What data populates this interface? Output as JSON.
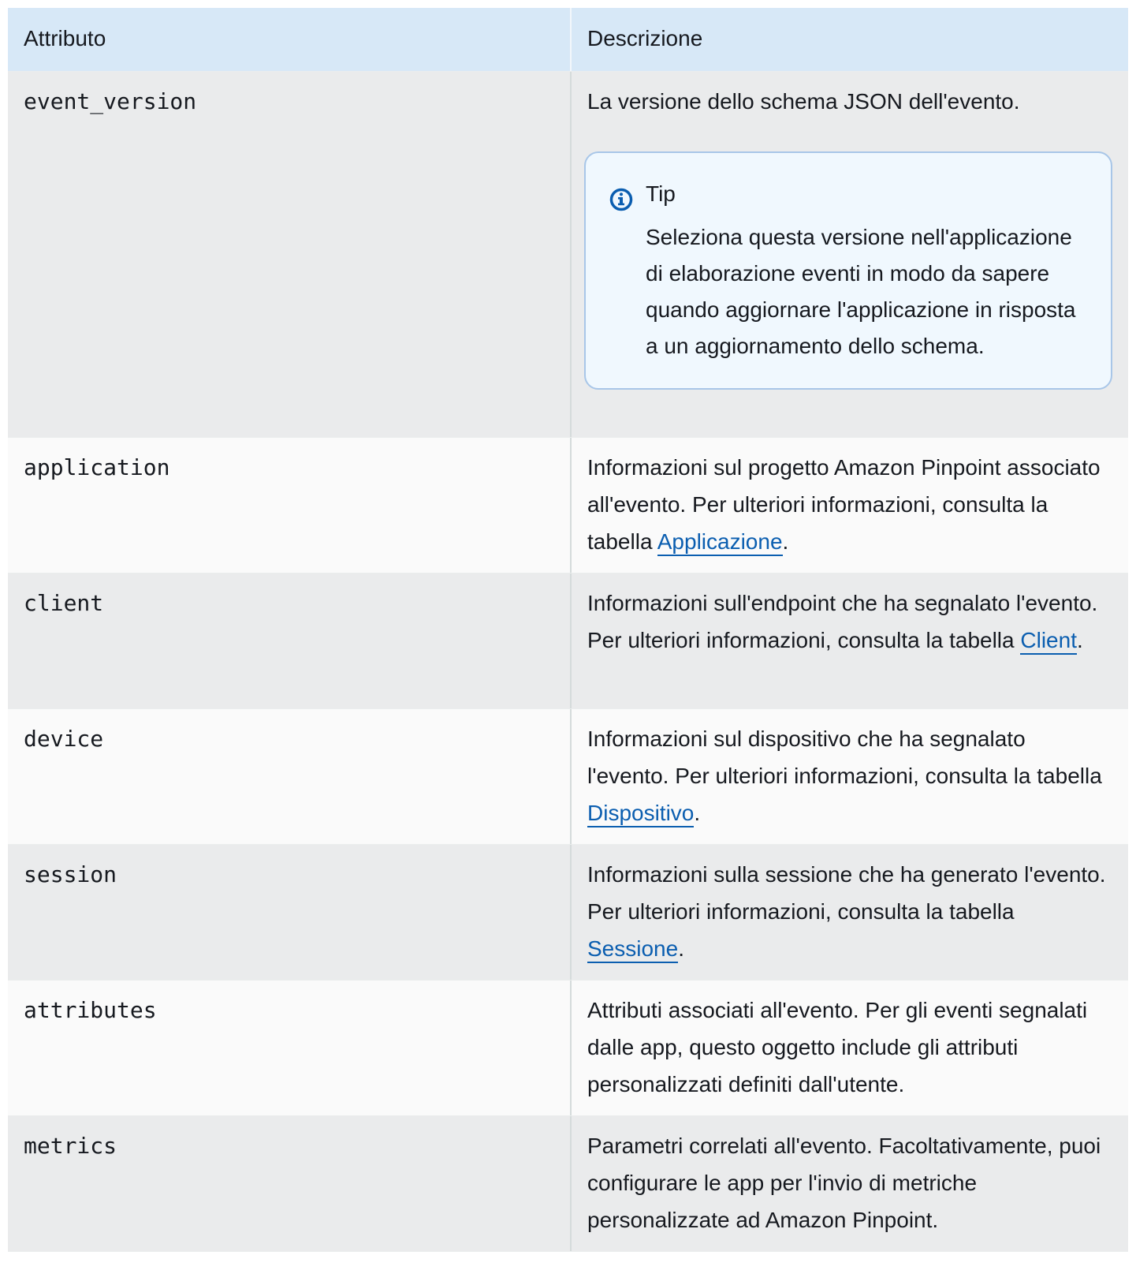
{
  "table": {
    "headers": {
      "attribute": "Attributo",
      "description": "Descrizione"
    },
    "rows": [
      {
        "attribute": "event_version",
        "description": "La versione dello schema JSON dell'evento.",
        "tip": {
          "title": "Tip",
          "icon": "info-icon",
          "text": "Seleziona questa versione nell'applicazione di elaborazione eventi in modo da sapere quando aggiornare l'applicazione in risposta a un aggiornamento dello schema."
        }
      },
      {
        "attribute": "application",
        "description_before": "Informazioni sul progetto Amazon Pinpoint associato all'evento. Per ulteriori informazioni, consulta la tabella ",
        "link": "Applicazione",
        "description_after": "."
      },
      {
        "attribute": "client",
        "description_before": "Informazioni sull'endpoint che ha segnalato l'evento. Per ulteriori informazioni, consulta la tabella ",
        "link": "Client",
        "description_after": "."
      },
      {
        "attribute": "device",
        "description_before": "Informazioni sul dispositivo che ha segnalato l'evento. Per ulteriori informazioni, consulta la tabella ",
        "link": "Dispositivo",
        "description_after": "."
      },
      {
        "attribute": "session",
        "description_before": "Informazioni sulla sessione che ha generato l'evento. Per ulteriori informazioni, consulta la tabella ",
        "link": "Sessione",
        "description_after": "."
      },
      {
        "attribute": "attributes",
        "description": "Attributi associati all'evento. Per gli eventi segnalati dalle app, questo oggetto include gli attributi personalizzati definiti dall'utente."
      },
      {
        "attribute": "metrics",
        "description": "Parametri correlati all'evento. Facoltativamente, puoi configurare le app per l'invio di metriche personalizzate ad Amazon Pinpoint."
      }
    ]
  },
  "colors": {
    "header_bg": "#d7e8f7",
    "row_gray": "#eaebec",
    "row_white": "#fafafa",
    "link": "#0b5eb0",
    "tip_bg": "#f0f8fe",
    "tip_border": "#a8c6e8",
    "info_icon": "#0b5eb0"
  }
}
